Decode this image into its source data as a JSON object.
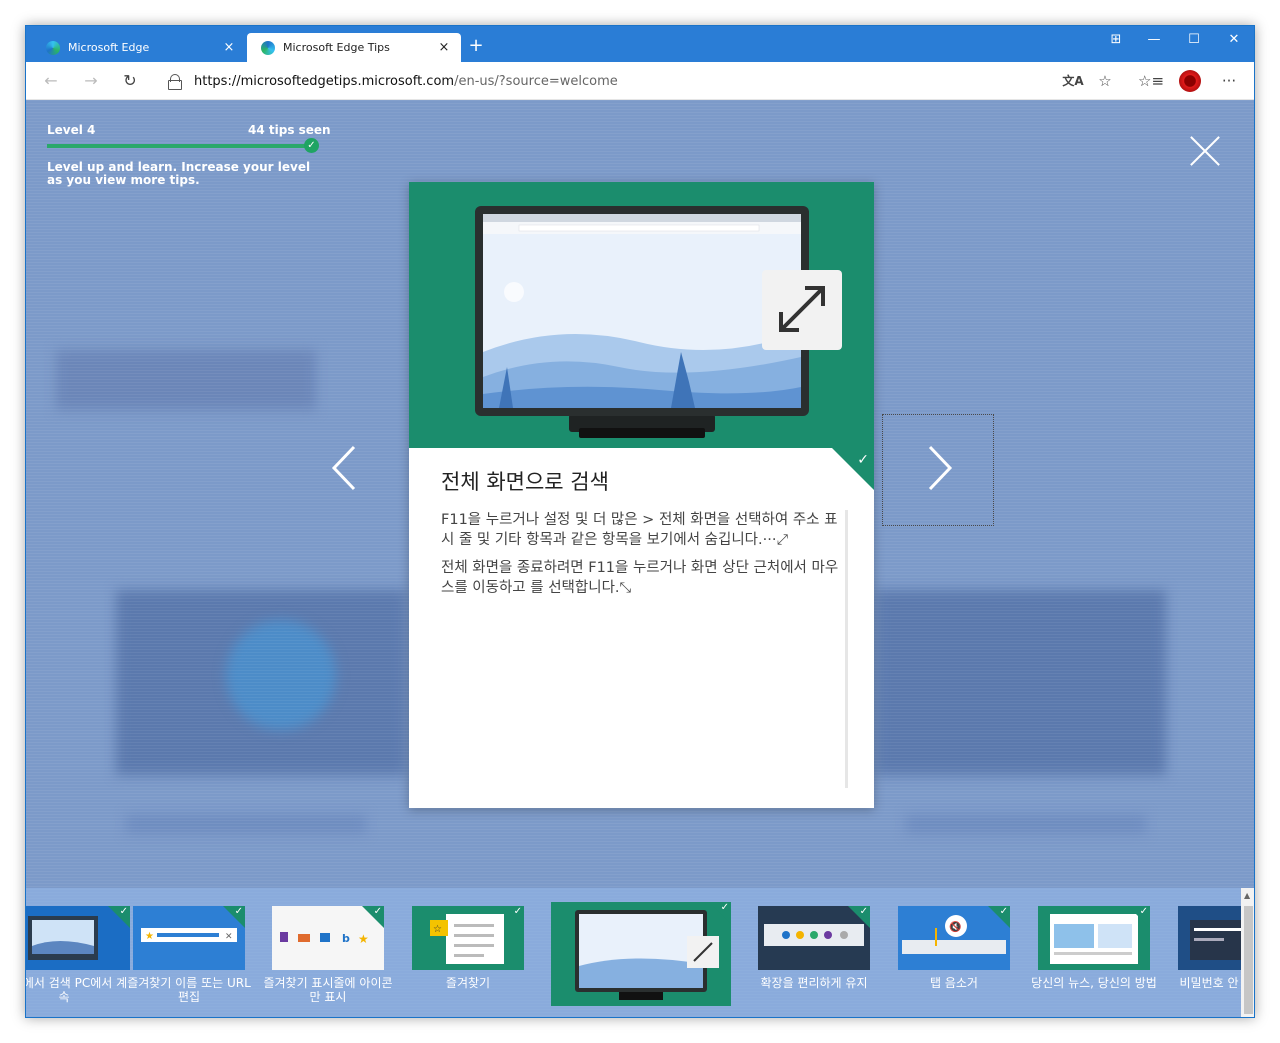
{
  "browser": {
    "tabs": [
      {
        "title": "Microsoft Edge",
        "close": "×"
      },
      {
        "title": "Microsoft Edge Tips",
        "close": "×"
      }
    ],
    "new_tab": "+",
    "window_controls": {
      "menu": "⊞",
      "minimize": "—",
      "maximize": "☐",
      "close": "✕"
    },
    "address": {
      "host": "https://microsoftedgetips.microsoft.com",
      "path": "/en-us/?source=welcome"
    }
  },
  "progress": {
    "level_label": "Level 4",
    "tips_seen": "44 tips seen",
    "message": "Level up and learn. Increase your level as you view more tips.",
    "fill_fraction": 1.0
  },
  "tip": {
    "title": "전체 화면으로 검색",
    "paragraph_1": "F11을 누르거나 설정 및 더 많은 > 전체 화면을 선택하여 주소 표시 줄 및 기타 항목과 같은 항목을 보기에서 숨깁니다.···⤢",
    "paragraph_2": "전체 화면을 종료하려면 F11을 누르거나 화면 상단 근처에서 마우스를 이동하고 를 선택합니다.⤡"
  },
  "thumbnails": [
    {
      "label": "전화에서 검색 PC에서 계속"
    },
    {
      "label": "즐겨찾기 이름 또는 URL 편집"
    },
    {
      "label": "즐겨찾기 표시줄에 아이콘만 표시"
    },
    {
      "label": "즐겨찾기"
    },
    {
      "label": ""
    },
    {
      "label": "확장을 편리하게 유지"
    },
    {
      "label": "탭 음소거"
    },
    {
      "label": "당신의 뉴스, 당신의 방법"
    },
    {
      "label": "비밀번호 안"
    }
  ],
  "colors": {
    "titlebar": "#2a7dd6",
    "accent_green": "#1b8d6d",
    "overlay": "#7c9ac9"
  }
}
